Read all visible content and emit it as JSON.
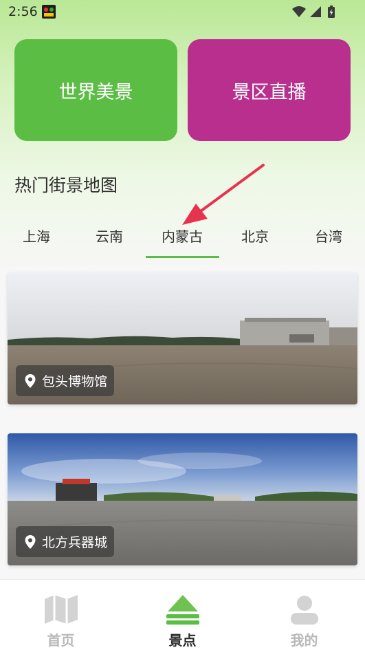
{
  "status_bar": {
    "time": "2:56"
  },
  "buttons": {
    "world_scenery": "世界美景",
    "scenic_live": "景区直播"
  },
  "section_title": "热门街景地图",
  "tabs": [
    {
      "label": "上海"
    },
    {
      "label": "云南"
    },
    {
      "label": "内蒙古",
      "selected": true
    },
    {
      "label": "北京"
    },
    {
      "label": "台湾"
    }
  ],
  "spots": [
    {
      "name": "包头博物馆"
    },
    {
      "name": "北方兵器城"
    }
  ],
  "bottom_nav": [
    {
      "label": "首页",
      "icon": "map-icon",
      "active": false
    },
    {
      "label": "景点",
      "icon": "mountain-icon",
      "active": true
    },
    {
      "label": "我的",
      "icon": "person-icon",
      "active": false
    }
  ],
  "colors": {
    "accent_green": "#5cbd45",
    "live_magenta": "#b82f8e",
    "annotation_red": "#e8334f"
  }
}
